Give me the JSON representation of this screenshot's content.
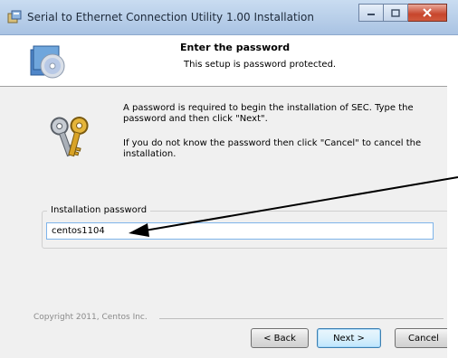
{
  "window": {
    "title": "Serial to Ethernet Connection Utility 1.00 Installation",
    "icons": {
      "app": "installer-icon",
      "minimize": "minimize-icon",
      "maximize": "maximize-icon",
      "close": "close-icon"
    }
  },
  "header": {
    "title": "Enter the password",
    "subtitle": "This setup is password protected.",
    "icon": "cd-installer-icon"
  },
  "body": {
    "icon": "keys-icon",
    "message1": "A password is required to begin the installation of SEC. Type the password and then click \"Next\".",
    "message2": "If you do not know the password then click \"Cancel\" to cancel the installation."
  },
  "password_group": {
    "label": "Installation password",
    "value": "centos1104"
  },
  "footer": {
    "copyright": "Copyright 2011, Centos Inc.",
    "back_label": "< Back",
    "next_label": "Next >",
    "cancel_label": "Cancel"
  },
  "colors": {
    "titlebar": "#b6cde8",
    "close_button": "#c7452c",
    "input_border": "#7eb4ea",
    "default_button": "#3c7fb1"
  }
}
